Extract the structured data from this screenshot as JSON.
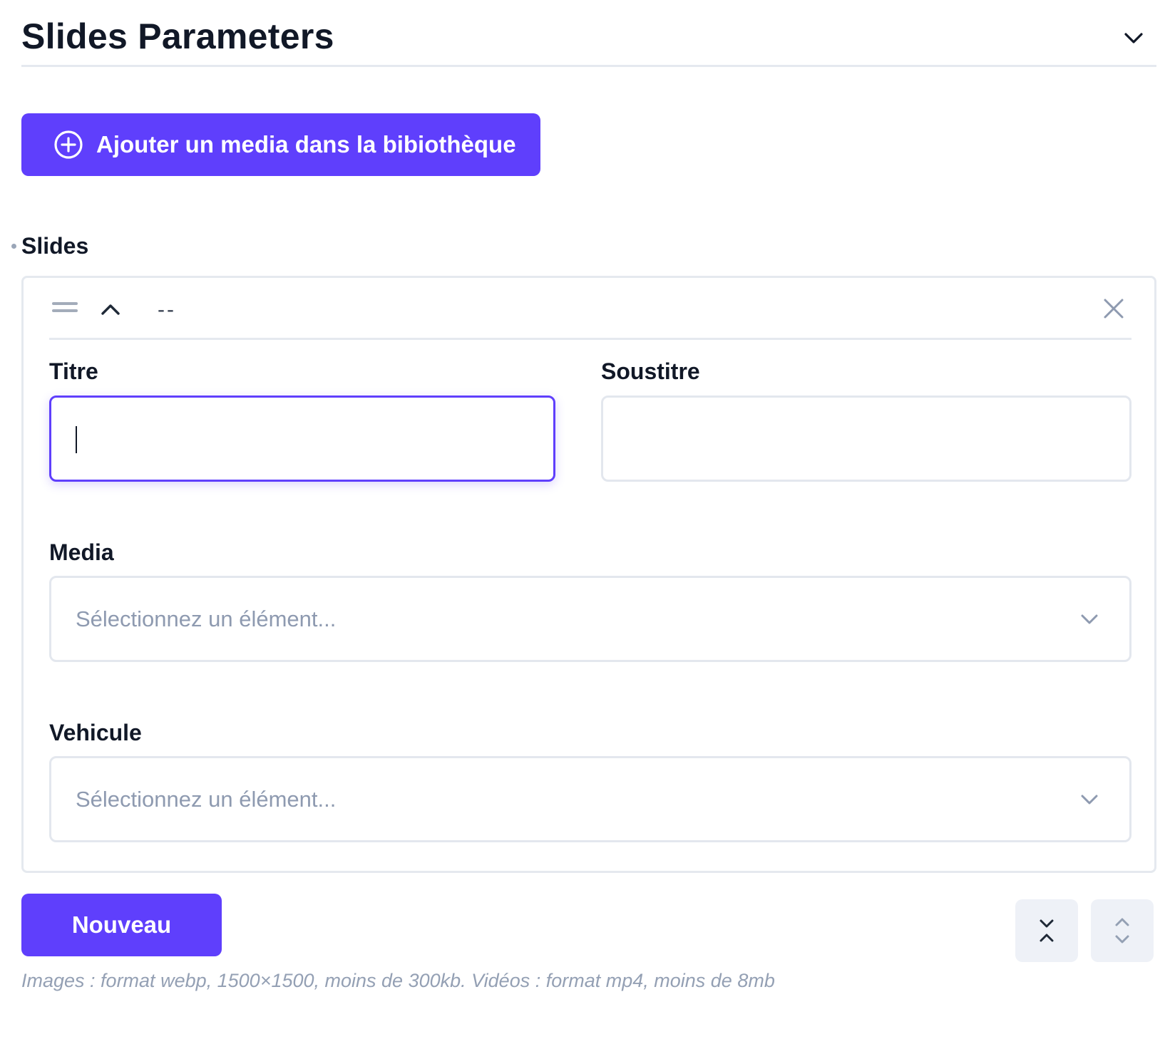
{
  "section": {
    "title": "Slides Parameters",
    "toggle_icon": "chevron-down-icon"
  },
  "add_media_button": {
    "label": "Ajouter un media dans la bibiothèque",
    "icon": "plus-circle-icon"
  },
  "slides": {
    "label": "Slides",
    "items": [
      {
        "label": "--",
        "fields": {
          "titre": {
            "label": "Titre",
            "value": ""
          },
          "soustitre": {
            "label": "Soustitre",
            "value": ""
          },
          "media": {
            "label": "Media",
            "placeholder": "Sélectionnez un élément..."
          },
          "vehicule": {
            "label": "Vehicule",
            "placeholder": "Sélectionnez un élément..."
          }
        }
      }
    ]
  },
  "new_button": {
    "label": "Nouveau"
  },
  "controls": {
    "collapse_all_icon": "collapse-all-icon",
    "expand_all_icon": "expand-all-icon"
  },
  "help_text": "Images : format webp, 1500×1500, moins de 300kb. Vidéos : format mp4, moins de 8mb",
  "colors": {
    "accent": "#5f3ffc",
    "text": "#111827",
    "muted": "#94a0b4",
    "border": "#e3e7ee"
  }
}
